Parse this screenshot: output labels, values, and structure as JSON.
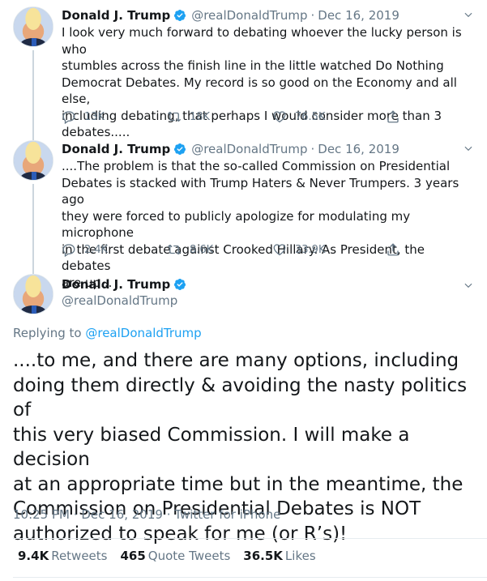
{
  "tweets": [
    {
      "name": "Donald J. Trump",
      "handle": "@realDonaldTrump",
      "date": "Dec 16, 2019",
      "lines": [
        "I look very much forward to debating whoever the lucky person is who",
        "stumbles across the finish line in the little watched Do Nothing",
        "Democrat Debates. My record is so good on the Economy and all else,",
        "including debating, that perhaps I would consider more than 3",
        "debates....."
      ],
      "replies": "13K",
      "retweets": "18K",
      "likes": "76.5K"
    },
    {
      "name": "Donald J. Trump",
      "handle": "@realDonaldTrump",
      "date": "Dec 16, 2019",
      "lines": [
        "....The problem is that the so-called Commission on Presidential",
        "Debates is stacked with Trump Haters & Never Trumpers. 3 years ago",
        "they were forced to publicly apologize for modulating my microphone",
        "in the first debate against Crooked Hillary. As President, the debates",
        "are up..."
      ],
      "replies": "2.4K",
      "retweets": "8.6K",
      "likes": "33.9K"
    }
  ],
  "main": {
    "name": "Donald J. Trump",
    "handle": "@realDonaldTrump",
    "replying_prefix": "Replying to",
    "replying_to": "@realDonaldTrump",
    "lines": [
      "....to me, and there are many options, including",
      "doing them directly & avoiding the nasty politics of",
      "this very biased Commission. I will make a decision",
      "at an appropriate time but in the meantime, the",
      "Commission on Presidential Debates is NOT",
      "authorized to speak for me (or R’s)!"
    ],
    "time": "10:25 PM",
    "date": "Dec 16, 2019",
    "source": "Twitter for iPhone",
    "separator": "·",
    "retweets": "9.4K",
    "retweets_label": "Retweets",
    "quotes": "465",
    "quotes_label": "Quote Tweets",
    "likes": "36.5K",
    "likes_label": "Likes"
  },
  "colors": {
    "accent": "#1da1f2",
    "secondary_text": "#657786"
  },
  "icons": [
    "verified-badge-icon",
    "chevron-down-icon",
    "reply-icon",
    "retweet-icon",
    "like-icon",
    "share-icon"
  ]
}
